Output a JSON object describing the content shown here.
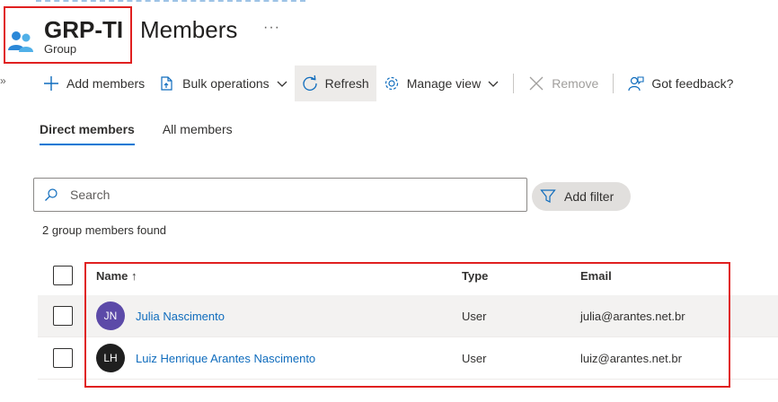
{
  "header": {
    "title": "GRP-TI",
    "subtitle": "Group",
    "page_title": "Members",
    "more": "···"
  },
  "toolbar": {
    "add_members": "Add members",
    "bulk_operations": "Bulk operations",
    "refresh": "Refresh",
    "manage_view": "Manage view",
    "remove": "Remove",
    "feedback": "Got feedback?"
  },
  "tabs": [
    {
      "label": "Direct members",
      "selected": true
    },
    {
      "label": "All members",
      "selected": false
    }
  ],
  "search": {
    "placeholder": "Search"
  },
  "filter": {
    "label": "Add filter"
  },
  "count_text": "2 group members found",
  "table": {
    "columns": [
      "Name ↑",
      "Type",
      "Email"
    ],
    "rows": [
      {
        "initials": "JN",
        "name": "Julia Nascimento",
        "type": "User",
        "email": "julia@arantes.net.br",
        "avatar_color": "#5c4aa8"
      },
      {
        "initials": "LH",
        "name": "Luiz Henrique Arantes Nascimento",
        "type": "User",
        "email": "luiz@arantes.net.br",
        "avatar_color": "#1f1f1f"
      }
    ]
  },
  "colors": {
    "accent": "#0078d4",
    "link": "#0f6cbd",
    "highlight": "#e02020"
  }
}
